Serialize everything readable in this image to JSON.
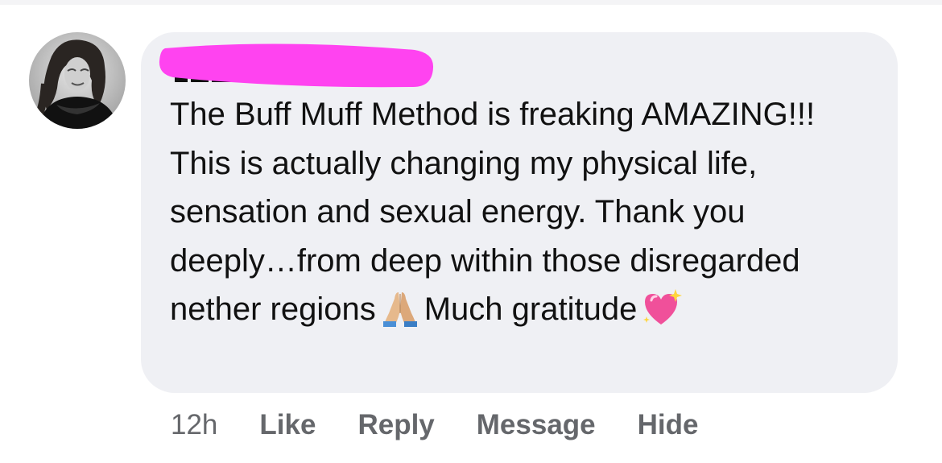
{
  "comment": {
    "text_part1": "The Buff Muff Method is freaking AMAZING!!! This is actually changing my physical life, sensation and sexual energy. Thank you deeply…from deep within those disregarded nether regions",
    "text_part2": "Much gratitude",
    "emoji_1": "folded-hands-icon",
    "emoji_2": "sparkling-heart-icon"
  },
  "actions": {
    "timestamp": "12h",
    "like": "Like",
    "reply": "Reply",
    "message": "Message",
    "hide": "Hide"
  },
  "colors": {
    "bubble_bg": "#eff0f4",
    "redaction": "#ff43f0",
    "action_text": "#65676b",
    "comment_text": "#111111"
  }
}
